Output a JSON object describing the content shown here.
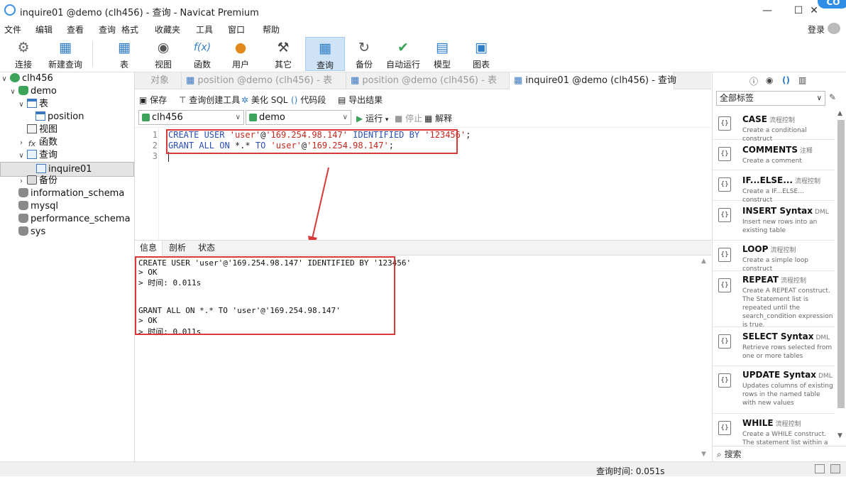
{
  "window": {
    "title": "inquire01 @demo (clh456) - 查询 - Navicat Premium",
    "badge": "CO"
  },
  "menu": [
    "文件",
    "编辑",
    "查看",
    "查询",
    "格式",
    "收藏夹",
    "工具",
    "窗口",
    "帮助"
  ],
  "login": "登录",
  "toolbar": [
    {
      "label": "连接",
      "icon": "connect-icon"
    },
    {
      "label": "新建查询",
      "icon": "new-query-icon"
    },
    {
      "label": "表",
      "icon": "table-icon"
    },
    {
      "label": "视图",
      "icon": "view-icon"
    },
    {
      "label": "函数",
      "icon": "function-icon",
      "glyph": "f(x)"
    },
    {
      "label": "用户",
      "icon": "user-icon"
    },
    {
      "label": "其它",
      "icon": "tools-icon"
    },
    {
      "label": "查询",
      "icon": "query-icon",
      "active": true
    },
    {
      "label": "备份",
      "icon": "backup-icon"
    },
    {
      "label": "自动运行",
      "icon": "autorun-icon"
    },
    {
      "label": "模型",
      "icon": "model-icon"
    },
    {
      "label": "图表",
      "icon": "chart-icon"
    }
  ],
  "tree": [
    {
      "label": "clh456"
    },
    {
      "label": "demo"
    },
    {
      "label": "表"
    },
    {
      "label": "position"
    },
    {
      "label": "视图"
    },
    {
      "label": "函数"
    },
    {
      "label": "查询"
    },
    {
      "label": "inquire01",
      "selected": true
    },
    {
      "label": "备份"
    },
    {
      "label": "information_schema"
    },
    {
      "label": "mysql"
    },
    {
      "label": "performance_schema"
    },
    {
      "label": "sys"
    }
  ],
  "tabs": [
    {
      "label": "对象"
    },
    {
      "label": "position @demo (clh456) - 表"
    },
    {
      "label": "position @demo (clh456) - 表"
    },
    {
      "label": "inquire01 @demo (clh456) - 查询",
      "active": true
    }
  ],
  "query_toolbar": {
    "save": "保存",
    "builder": "查询创建工具",
    "beautify": "美化 SQL",
    "snippet": "代码段",
    "export": "导出结果"
  },
  "selectors": {
    "connection": "clh456",
    "database": "demo",
    "run": "运行",
    "stop": "停止",
    "explain": "解释"
  },
  "editor": {
    "line_numbers": [
      "1",
      "2",
      "3"
    ],
    "line1": {
      "kw1": "CREATE USER",
      "s1": "'user'",
      "at": "@",
      "s2": "'169.254.98.147'",
      "kw2": "IDENTIFIED BY",
      "s3": "'123456'",
      "end": ";"
    },
    "line2": {
      "kw1": "GRANT ALL ON",
      "mid": "*.*",
      "kw2": "TO",
      "s1": "'user'",
      "at": "@",
      "s2": "'169.254.98.147'",
      "end": ";"
    }
  },
  "result_tabs": [
    "信息",
    "剖析",
    "状态"
  ],
  "results": [
    "CREATE USER 'user'@'169.254.98.147' IDENTIFIED BY '123456'",
    "> OK",
    "> 时间: 0.011s",
    "",
    "",
    "GRANT ALL ON *.* TO 'user'@'169.254.98.147'",
    "> OK",
    "> 时间: 0.011s"
  ],
  "right_panel": {
    "filter": "全部标签",
    "snippets": [
      {
        "title": "CASE",
        "cat": "流程控制",
        "desc": "Create a conditional construct"
      },
      {
        "title": "COMMENTS",
        "cat": "注释",
        "desc": "Create a comment"
      },
      {
        "title": "IF...ELSE...",
        "cat": "流程控制",
        "desc": "Create a IF...ELSE... construct"
      },
      {
        "title": "INSERT Syntax",
        "cat": "DML",
        "desc": "Insert new rows into an existing table"
      },
      {
        "title": "LOOP",
        "cat": "流程控制",
        "desc": "Create a simple loop construct"
      },
      {
        "title": "REPEAT",
        "cat": "流程控制",
        "desc": "Create A REPEAT construct. The Statement list is repeated until the search_condition expression is true."
      },
      {
        "title": "SELECT Syntax",
        "cat": "DML",
        "desc": "Retrieve rows selected from one or more tables"
      },
      {
        "title": "UPDATE Syntax",
        "cat": "DML",
        "desc": "Updates columns of existing rows in the named table with new values"
      },
      {
        "title": "WHILE",
        "cat": "流程控制",
        "desc": "Create a WHILE construct. The statement list within a WHILE"
      }
    ],
    "search": "搜索"
  },
  "status": {
    "query_time": "查询时间: 0.051s"
  },
  "colors": {
    "highlight": "#d83a3a",
    "accent": "#2f7dc8",
    "db_green": "#3ba35a"
  }
}
